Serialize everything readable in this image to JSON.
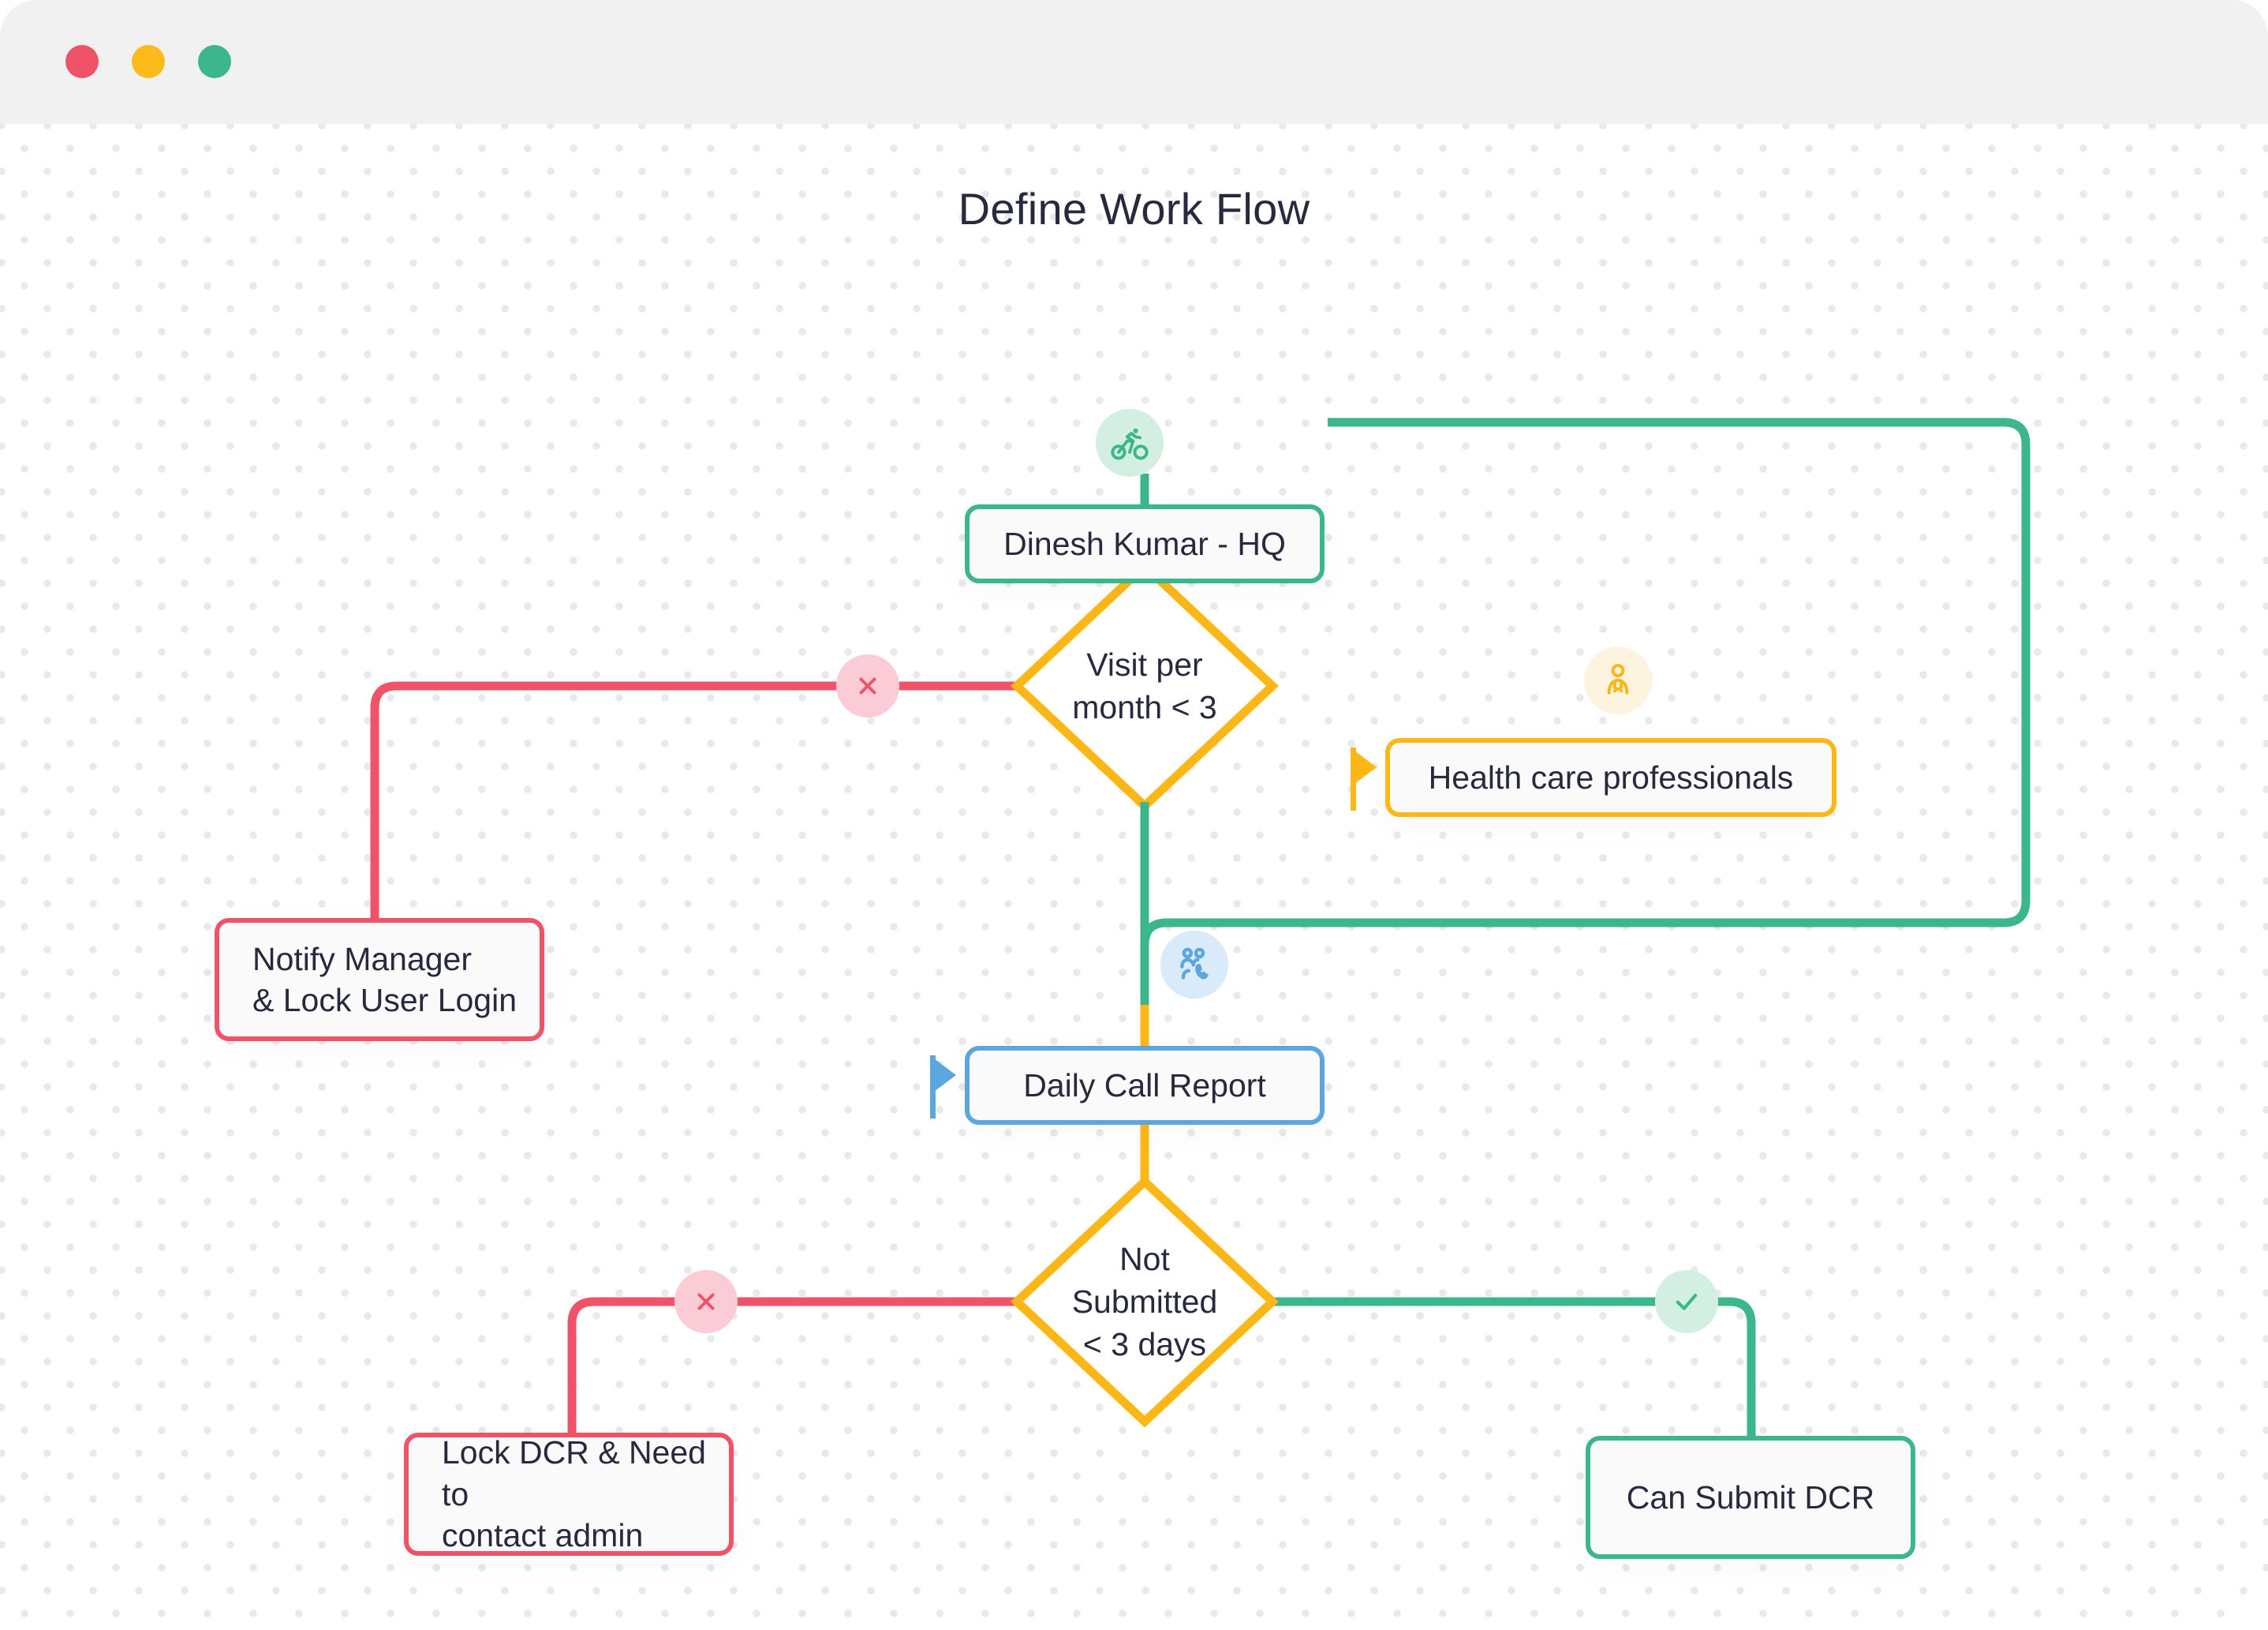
{
  "window": {
    "traffic_lights": [
      {
        "name": "close",
        "color": "#ef5368"
      },
      {
        "name": "minimize",
        "color": "#fcba1b"
      },
      {
        "name": "maximize",
        "color": "#3cb68b"
      }
    ]
  },
  "diagram": {
    "title": "Define Work Flow",
    "type": "flowchart",
    "palette": {
      "green": "#3cb68b",
      "amber": "#fbb715",
      "blue": "#5ba7dd",
      "pink": "#ef5368",
      "text": "#262a3c",
      "node_fill": "#fbfafb",
      "canvas": "#ffffff",
      "dot": "#e9e9ec"
    },
    "nodes": [
      {
        "id": "user",
        "label": "Dinesh Kumar - HQ",
        "shape": "rounded-rect",
        "color": "green",
        "align": "center"
      },
      {
        "id": "visit",
        "label": "Visit per\nmonth < 3",
        "shape": "diamond",
        "color": "amber",
        "align": "center"
      },
      {
        "id": "hcp",
        "label": "Health care professionals",
        "shape": "rounded-rect",
        "color": "amber",
        "align": "center"
      },
      {
        "id": "notify",
        "label": "Notify Manager\n& Lock User Login",
        "shape": "rounded-rect",
        "color": "pink",
        "align": "left"
      },
      {
        "id": "dcr",
        "label": "Daily Call Report",
        "shape": "rounded-rect",
        "color": "blue",
        "align": "center"
      },
      {
        "id": "notsub",
        "label": "Not\nSubmitted\n< 3 days",
        "shape": "diamond",
        "color": "amber",
        "align": "center"
      },
      {
        "id": "lockdcr",
        "label": "Lock DCR & Need to\ncontact admin",
        "shape": "rounded-rect",
        "color": "pink",
        "align": "left"
      },
      {
        "id": "cansubmit",
        "label": "Can Submit DCR",
        "shape": "rounded-rect",
        "color": "green",
        "align": "center"
      }
    ],
    "node_lines": {
      "user": [
        "Dinesh Kumar - HQ"
      ],
      "visit": [
        "Visit per",
        "month < 3"
      ],
      "hcp": [
        "Health care professionals"
      ],
      "notify": [
        "Notify Manager",
        "& Lock User Login"
      ],
      "dcr": [
        "Daily Call Report"
      ],
      "notsub": [
        "Not",
        "Submitted",
        "< 3 days"
      ],
      "lockdcr": [
        "Lock DCR & Need to",
        "contact admin"
      ],
      "cansubmit": [
        "Can Submit DCR"
      ]
    },
    "icons": [
      {
        "id": "bike-icon",
        "attached_to": "user",
        "bubble_color": "#d3efe1",
        "glyph_color": "#3cb68b"
      },
      {
        "id": "doctor-icon",
        "attached_to": "hcp",
        "bubble_color": "#fdf4e0",
        "glyph_color": "#fbb715"
      },
      {
        "id": "call-icon",
        "attached_to": "dcr",
        "bubble_color": "#d9eaf8",
        "glyph_color": "#5ba7dd"
      }
    ],
    "edges": [
      {
        "from": "user",
        "to": "visit",
        "color": "green",
        "badge": null
      },
      {
        "from": "user",
        "to": "dcr",
        "color": "green",
        "badge": null
      },
      {
        "from": "visit",
        "to": "notify",
        "color": "pink",
        "badge": "reject"
      },
      {
        "from": "visit",
        "to": "dcr",
        "color": "green",
        "badge": null
      },
      {
        "from": "dcr",
        "to": "notsub",
        "color": "amber",
        "badge": null
      },
      {
        "from": "notsub",
        "to": "lockdcr",
        "color": "pink",
        "badge": "reject"
      },
      {
        "from": "notsub",
        "to": "cansubmit",
        "color": "green",
        "badge": "accept"
      }
    ],
    "badges": [
      {
        "id": "reject-badge-visit",
        "symbol": "x",
        "bubble_color": "#fbccd6",
        "glyph_color": "#ef5368"
      },
      {
        "id": "reject-badge-notsub",
        "symbol": "x",
        "bubble_color": "#fbccd6",
        "glyph_color": "#ef5368"
      },
      {
        "id": "accept-badge-notsub",
        "symbol": "check",
        "bubble_color": "#d3efe1",
        "glyph_color": "#3cb68b"
      }
    ],
    "markers": [
      {
        "id": "flag-marker-hcp",
        "color": "amber",
        "points_to": "hcp"
      },
      {
        "id": "flag-marker-dcr",
        "color": "blue",
        "points_to": "dcr"
      }
    ]
  }
}
